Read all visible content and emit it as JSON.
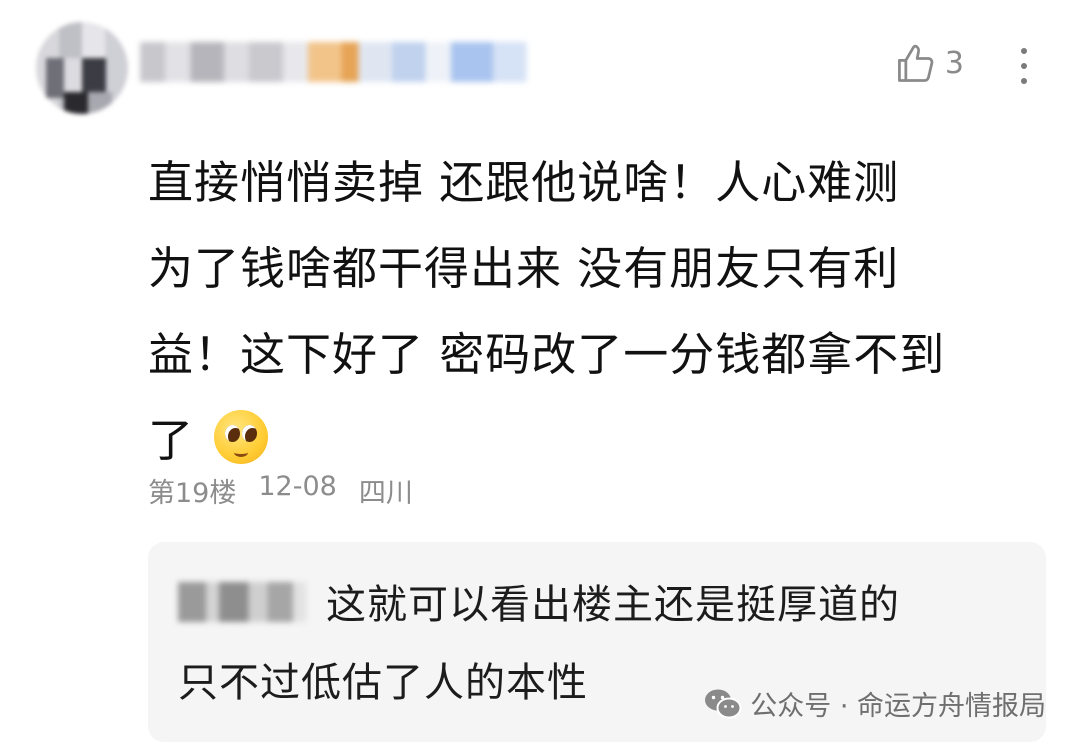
{
  "comment": {
    "likes": "3",
    "lines": [
      "直接悄悄卖掉 还跟他说啥！人心难测",
      "为了钱啥都干得出来 没有朋友只有利",
      "益！这下好了 密码改了一分钱都拿不到",
      "了"
    ],
    "emoji": "pleading-face-emoji",
    "floor": "第19楼",
    "date": "12-08",
    "location": "四川"
  },
  "reply": {
    "lines": [
      "这就可以看出楼主还是挺厚道的",
      "只不过低估了人的本性"
    ]
  },
  "watermark": {
    "icon": "wechat-icon",
    "text": "公众号 · 命运方舟情报局"
  },
  "colors": {
    "text_primary": "#111111",
    "text_secondary": "#8c8c8c",
    "reply_background": "#f5f5f5"
  }
}
